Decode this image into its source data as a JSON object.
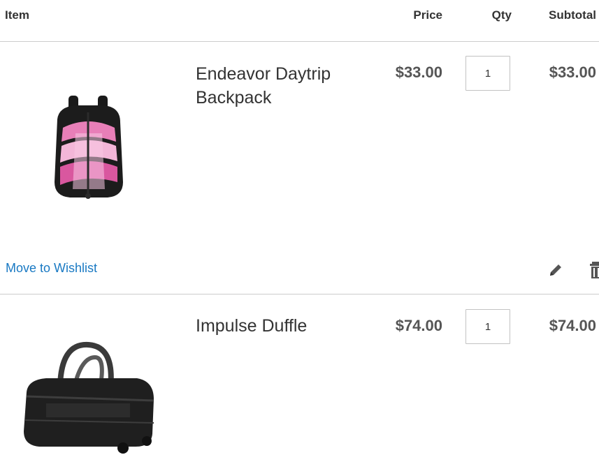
{
  "table": {
    "headers": {
      "item": "Item",
      "price": "Price",
      "qty": "Qty",
      "subtotal": "Subtotal"
    }
  },
  "items": [
    {
      "name": "Endeavor Daytrip Backpack",
      "price": "$33.00",
      "qty": "1",
      "subtotal": "$33.00",
      "image": "pink-black-backpack"
    },
    {
      "name": "Impulse Duffle",
      "price": "$74.00",
      "qty": "1",
      "subtotal": "$74.00",
      "image": "black-rolling-duffle"
    }
  ],
  "actions": {
    "wishlist_label": "Move to Wishlist",
    "edit_icon": "pencil-icon",
    "delete_icon": "trash-icon"
  },
  "colors": {
    "link": "#1979c3",
    "text": "#333333",
    "border": "#cccccc"
  }
}
